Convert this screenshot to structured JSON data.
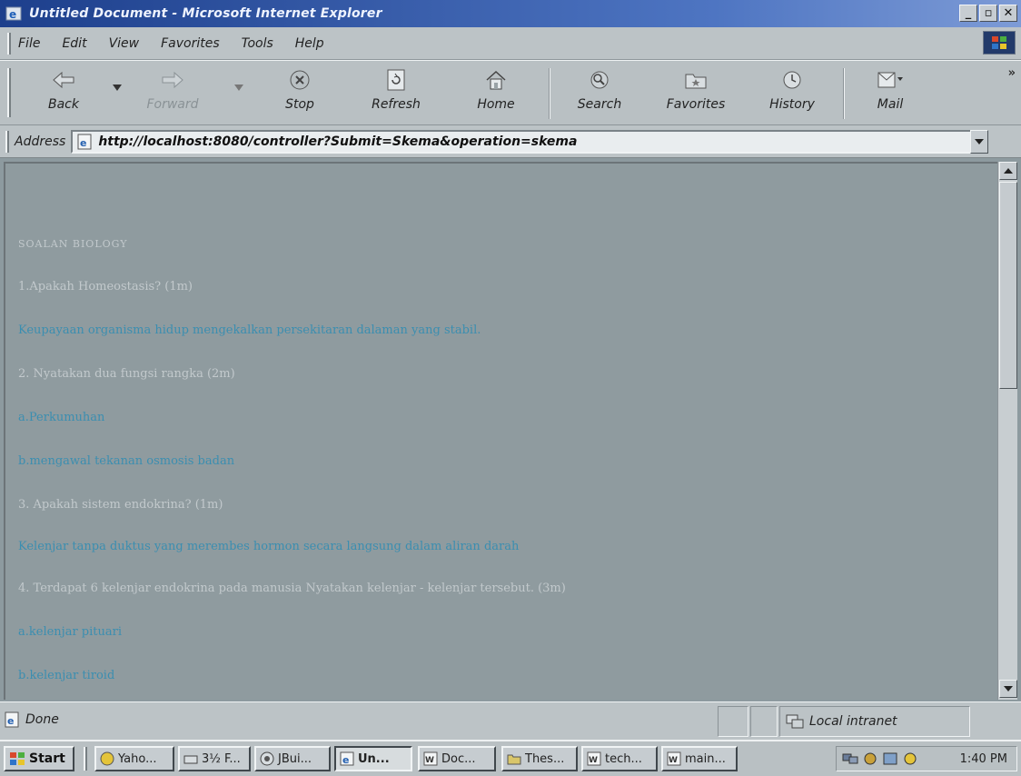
{
  "window": {
    "title": "Untitled Document - Microsoft Internet Explorer"
  },
  "menu": [
    "File",
    "Edit",
    "View",
    "Favorites",
    "Tools",
    "Help"
  ],
  "toolbar": {
    "back": "Back",
    "forward": "Forward",
    "stop": "Stop",
    "refresh": "Refresh",
    "home": "Home",
    "search": "Search",
    "favorites": "Favorites",
    "history": "History",
    "mail": "Mail",
    "more": "»"
  },
  "address": {
    "label": "Address",
    "url": "http://localhost:8080/controller?Submit=Skema&operation=skema"
  },
  "page": {
    "heading": "SOALAN BIOLOGY",
    "lines": [
      {
        "kind": "q",
        "text": "1.Apakah Homeostasis? (1m)"
      },
      {
        "kind": "a",
        "text": "Keupayaan organisma hidup mengekalkan persekitaran dalaman yang stabil."
      },
      {
        "kind": "q",
        "text": "2. Nyatakan dua fungsi rangka (2m)"
      },
      {
        "kind": "a",
        "text": "a.Perkumuhan"
      },
      {
        "kind": "a",
        "text": "b.mengawal tekanan osmosis badan"
      },
      {
        "kind": "q",
        "text": "3. Apakah sistem endokrina? (1m)"
      },
      {
        "kind": "a",
        "text": "Kelenjar tanpa duktus yang merembes hormon secara langsung dalam aliran darah"
      },
      {
        "kind": "q",
        "text": "4. Terdapat 6 kelenjar endokrina pada manusia Nyatakan kelenjar - kelenjar tersebut. (3m)"
      },
      {
        "kind": "a",
        "text": "a.kelenjar pituari"
      },
      {
        "kind": "a",
        "text": "b.kelenjar tiroid"
      }
    ]
  },
  "status": {
    "text": "Done",
    "zone": "Local intranet"
  },
  "taskbar": {
    "start": "Start",
    "tasks": [
      "Yaho...",
      "3½ F...",
      "JBui...",
      "Un...",
      "Doc...",
      "Thes...",
      "tech...",
      "main..."
    ],
    "clock": "1:40 PM"
  }
}
